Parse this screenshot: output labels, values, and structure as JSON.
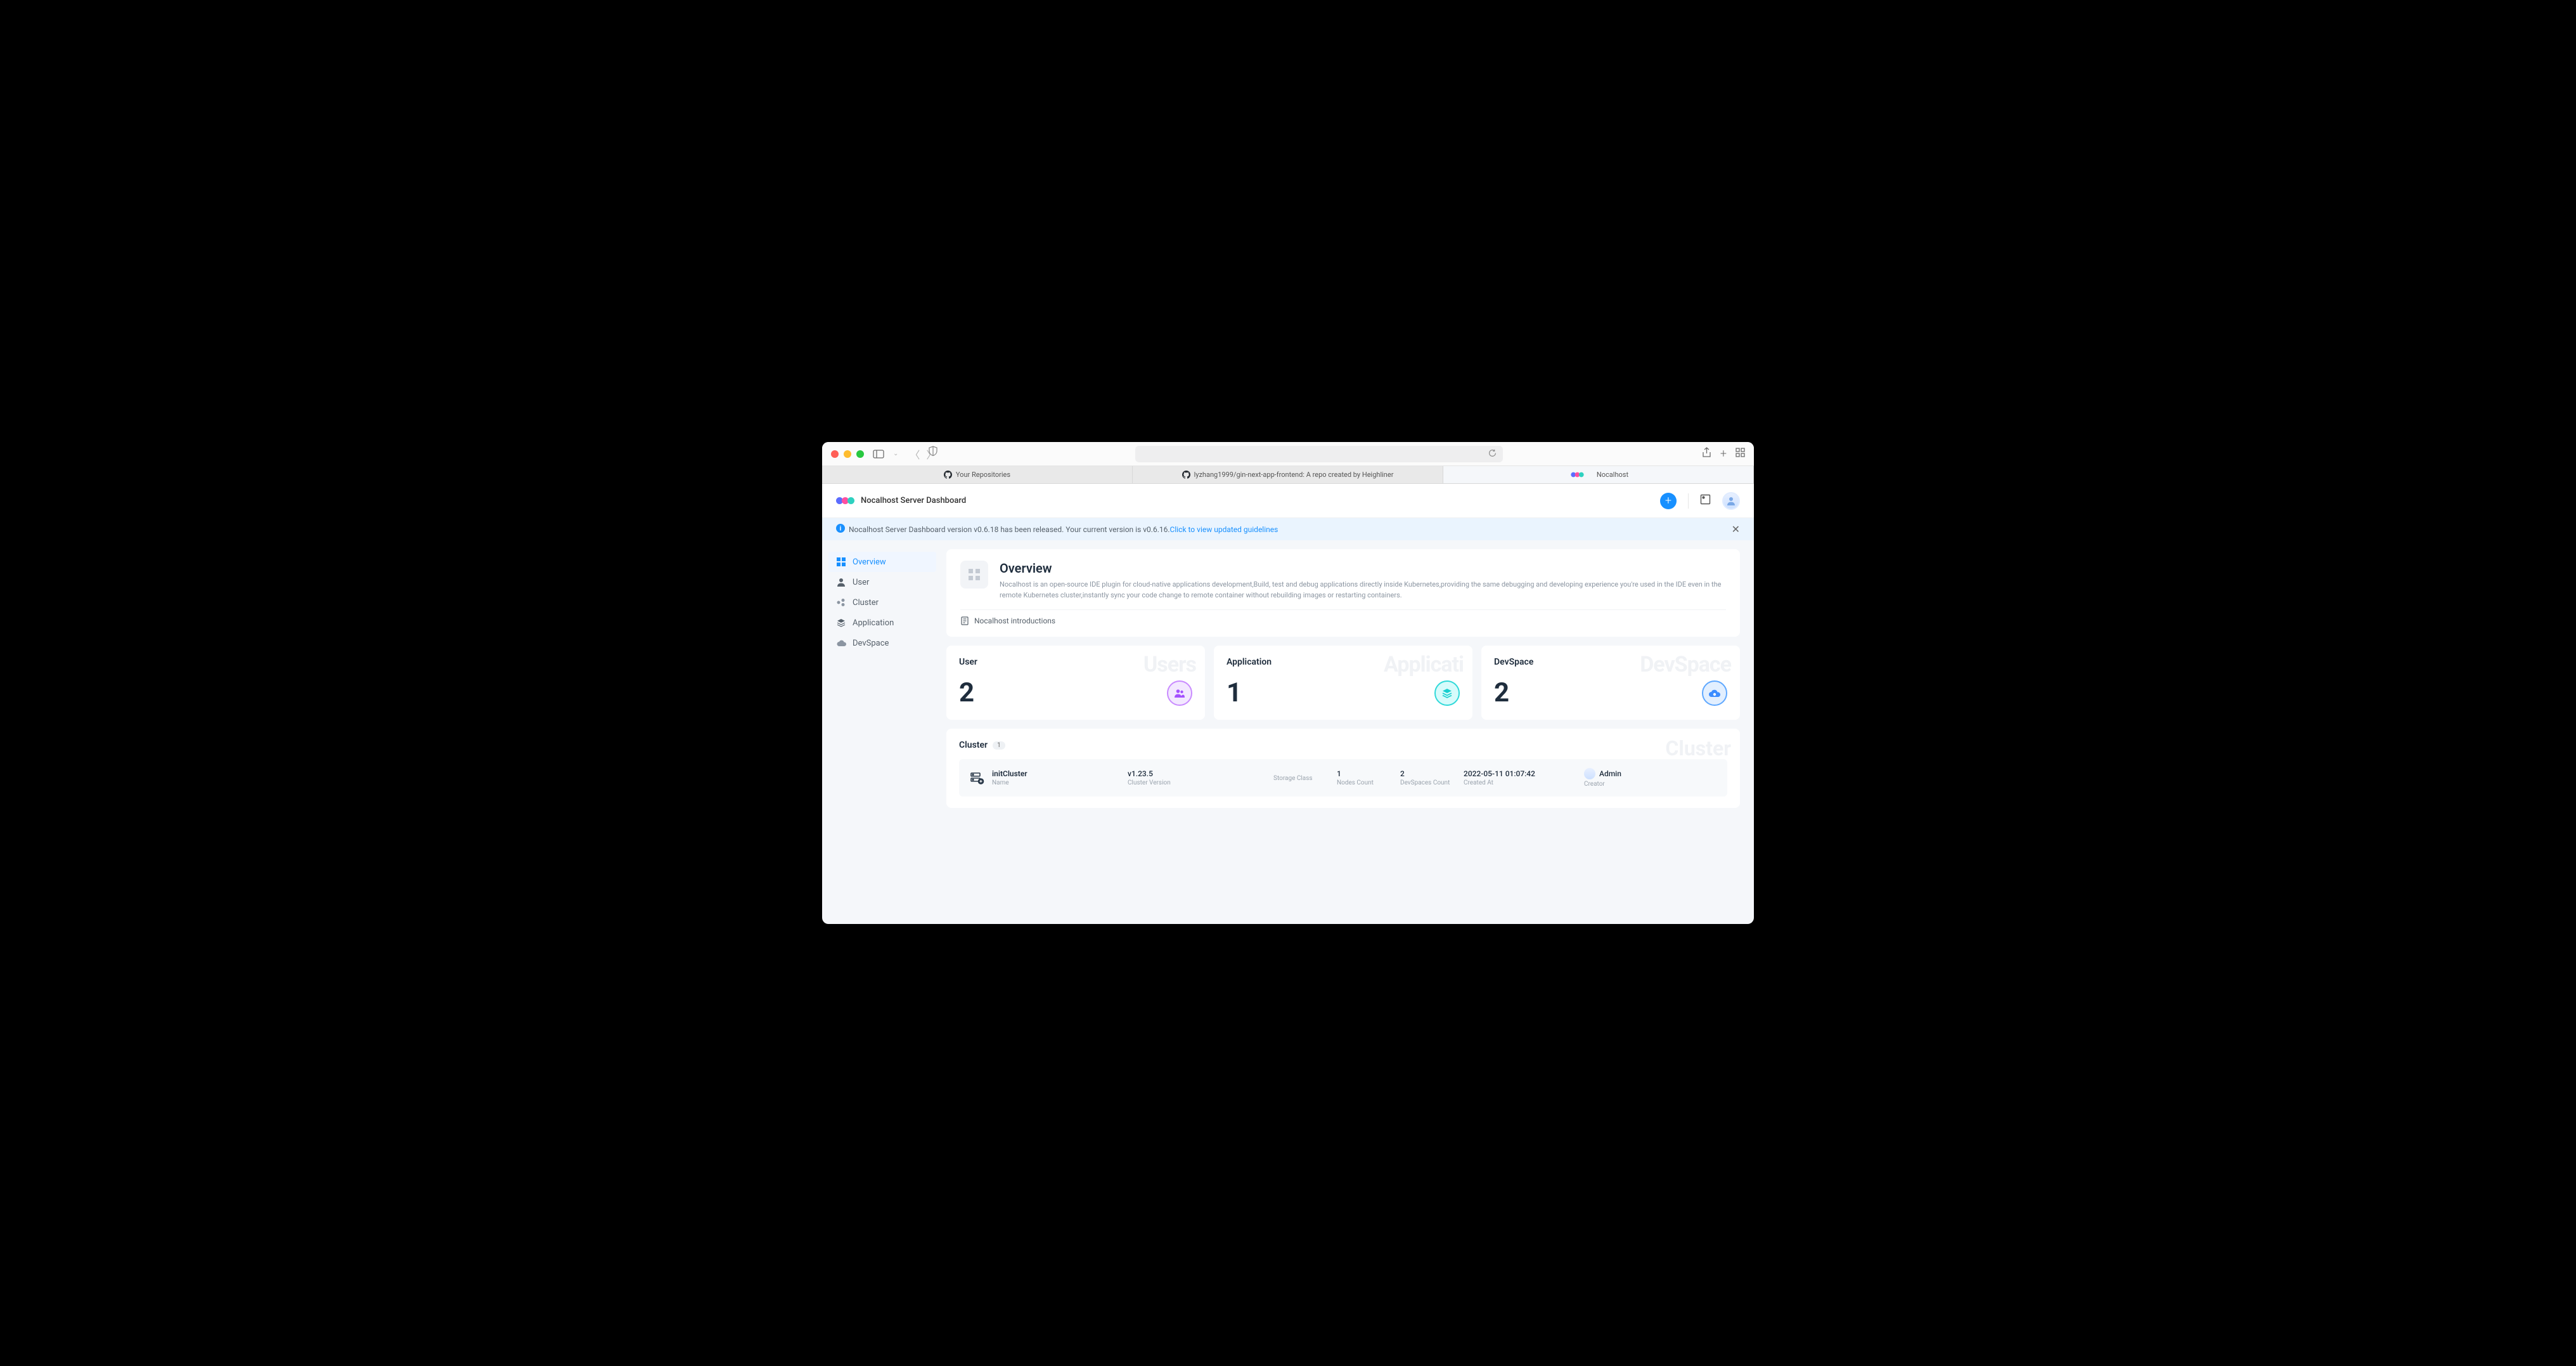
{
  "browser": {
    "tabs": [
      {
        "label": "Your Repositories",
        "active": false,
        "icon": "github"
      },
      {
        "label": "lyzhang1999/gin-next-app-frontend: A repo created by Heighliner",
        "active": false,
        "icon": "github"
      },
      {
        "label": "Nocalhost",
        "active": true,
        "icon": "nocalhost"
      }
    ]
  },
  "header": {
    "app_title": "Nocalhost Server Dashboard"
  },
  "banner": {
    "text": "Nocalhost Server Dashboard version v0.6.18 has been released. Your current version is v0.6.16.",
    "link": "Click to view updated guidelines"
  },
  "sidebar": {
    "items": [
      {
        "label": "Overview",
        "active": true
      },
      {
        "label": "User",
        "active": false
      },
      {
        "label": "Cluster",
        "active": false
      },
      {
        "label": "Application",
        "active": false
      },
      {
        "label": "DevSpace",
        "active": false
      }
    ]
  },
  "overview": {
    "title": "Overview",
    "description": "Nocalhost is an open-source IDE plugin for cloud-native applications development,Build, test and debug applications directly inside Kubernetes,providing the same debugging and developing experience you're used in the IDE even in the remote Kubernetes cluster,instantly sync your code change to remote container without rebuilding images or restarting containers.",
    "intro_label": "Nocalhost introductions"
  },
  "stats": {
    "user": {
      "title": "User",
      "value": "2",
      "ghost": "Users"
    },
    "application": {
      "title": "Application",
      "value": "1",
      "ghost": "Applicati"
    },
    "devspace": {
      "title": "DevSpace",
      "value": "2",
      "ghost": "DevSpace"
    }
  },
  "cluster": {
    "title": "Cluster",
    "count": "1",
    "ghost": "Cluster",
    "columns": {
      "name": "Name",
      "version": "Cluster Version",
      "storage": "Storage Class",
      "nodes": "Nodes Count",
      "devspaces": "DevSpaces Count",
      "created": "Created At",
      "creator": "Creator"
    },
    "row": {
      "name": "initCluster",
      "version": "v1.23.5",
      "storage": "",
      "nodes": "1",
      "devspaces": "2",
      "created": "2022-05-11 01:07:42",
      "creator": "Admin"
    }
  }
}
